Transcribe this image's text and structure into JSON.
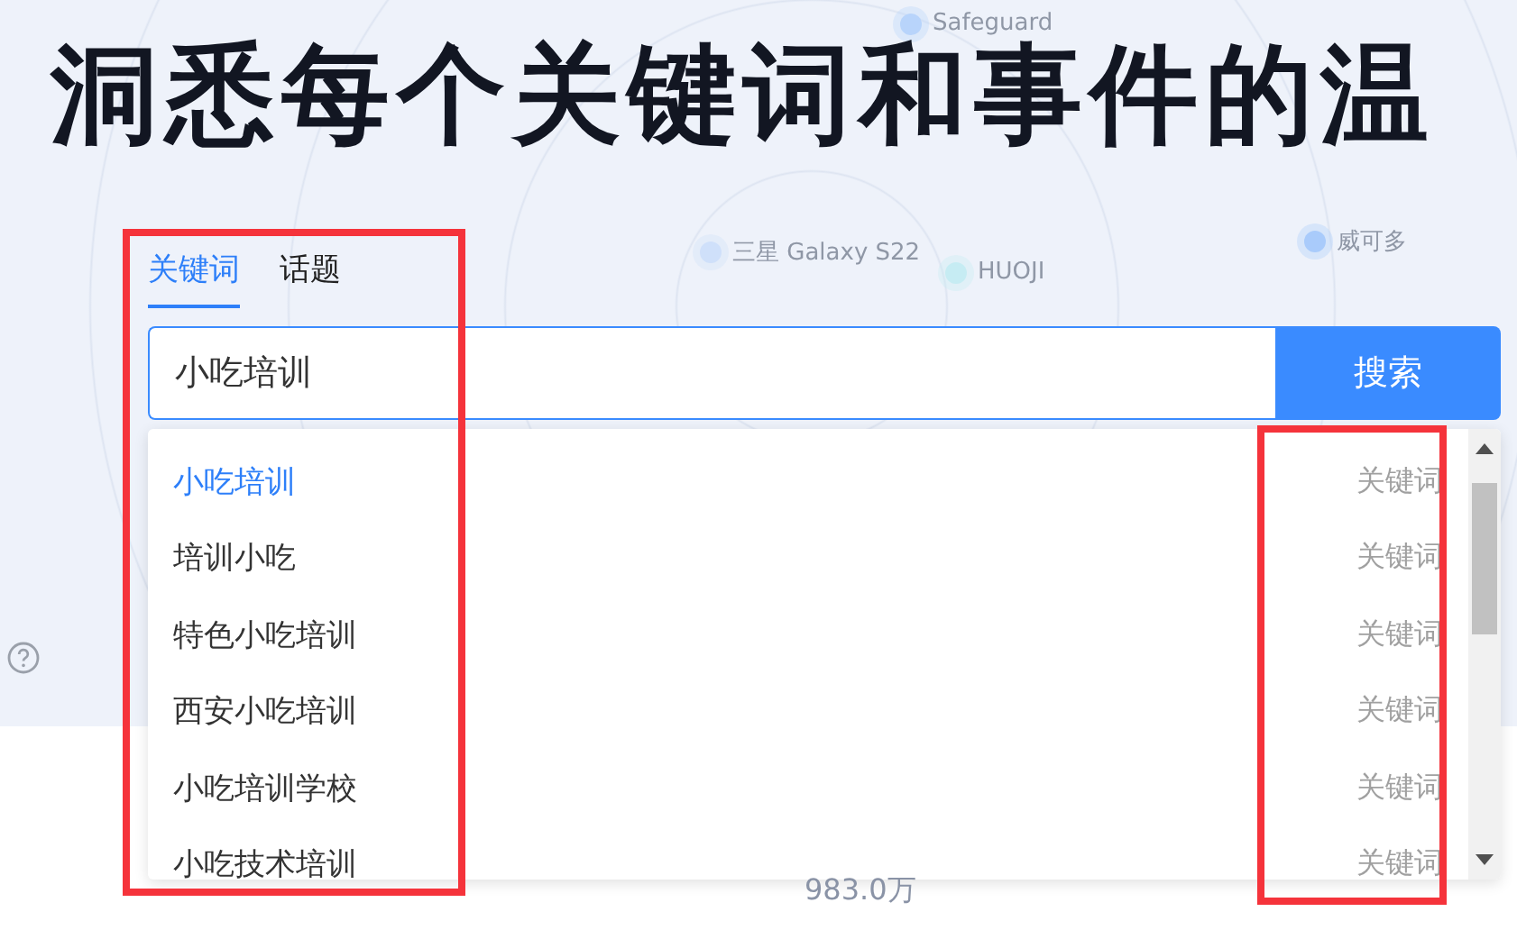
{
  "headline": "洞悉每个关键词和事件的温",
  "bubbles": [
    {
      "label": "Safeguard"
    },
    {
      "label": "三星 Galaxy S22"
    },
    {
      "label": "HUOJI"
    },
    {
      "label": "威可多"
    }
  ],
  "tabs": [
    {
      "label": "关键词",
      "selected": true
    },
    {
      "label": "话题",
      "selected": false
    }
  ],
  "search": {
    "value": "小吃培训",
    "button": "搜索"
  },
  "suggestions": [
    {
      "text": "小吃培训",
      "type": "关键词",
      "selected": true
    },
    {
      "text": "培训小吃",
      "type": "关键词",
      "selected": false
    },
    {
      "text": "特色小吃培训",
      "type": "关键词",
      "selected": false
    },
    {
      "text": "西安小吃培训",
      "type": "关键词",
      "selected": false
    },
    {
      "text": "小吃培训学校",
      "type": "关键词",
      "selected": false
    },
    {
      "text": "小吃技术培训",
      "type": "关键词",
      "selected": false
    }
  ],
  "footer_value": "983.0万"
}
